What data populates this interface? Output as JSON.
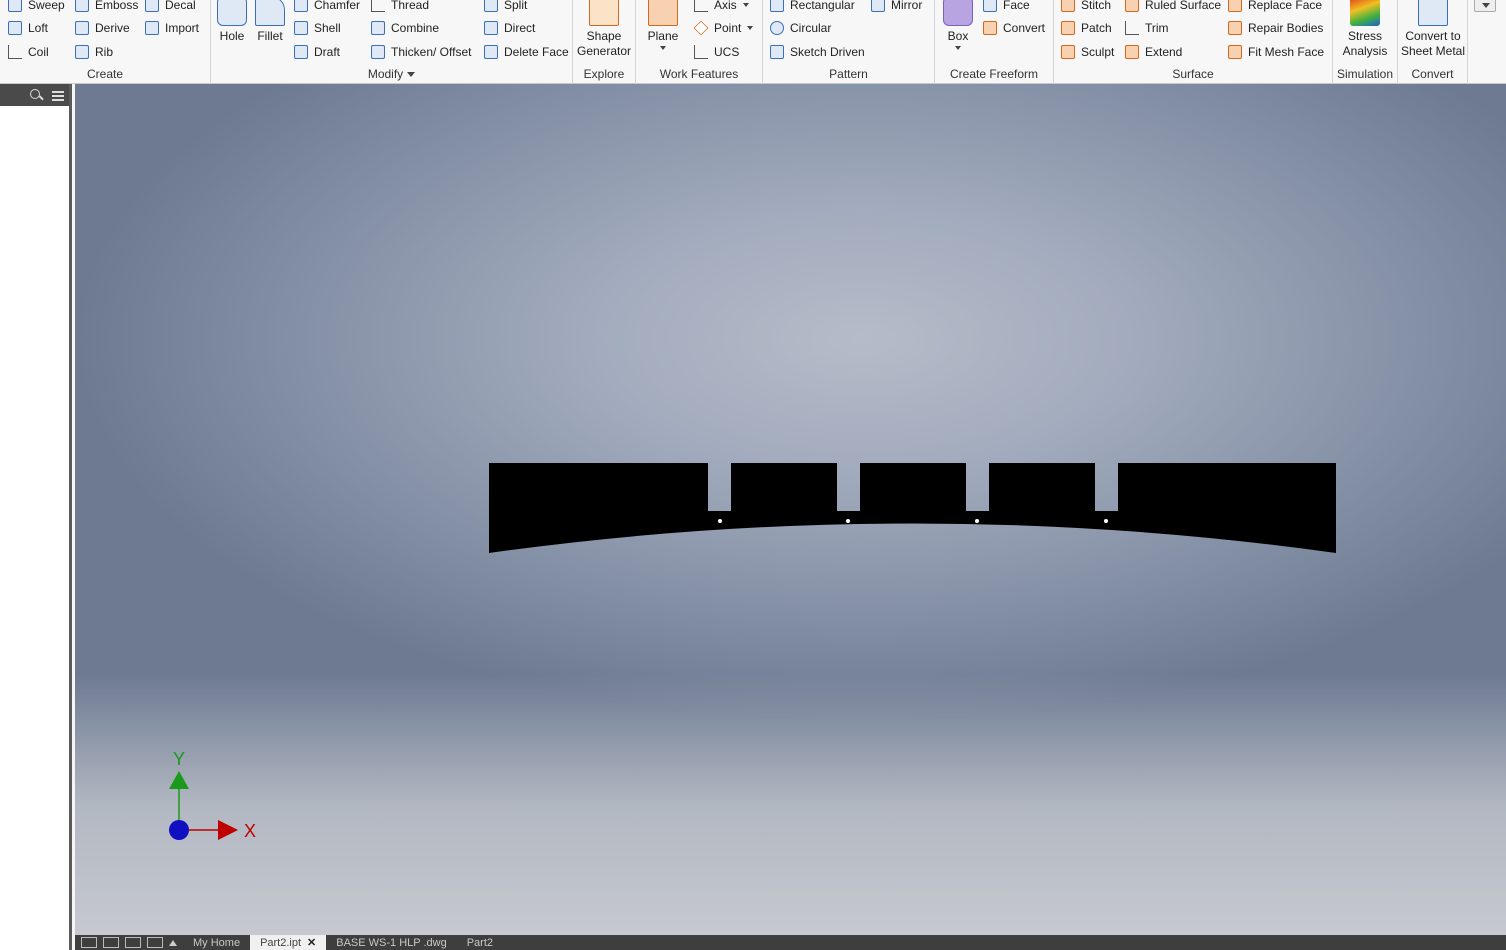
{
  "ribbon": {
    "create": {
      "title": "Create",
      "items": [
        "Sweep",
        "Emboss",
        "Decal",
        "Loft",
        "Derive",
        "Import",
        "Coil",
        "Rib"
      ]
    },
    "modify": {
      "title": "Modify",
      "large": [
        "Hole",
        "Fillet"
      ],
      "items": [
        "Chamfer",
        "Thread",
        "Split",
        "Shell",
        "Combine",
        "Direct",
        "Draft",
        "Thicken/ Offset",
        "Delete Face"
      ]
    },
    "explore": {
      "title": "Explore",
      "large_line1": "Shape",
      "large_line2": "Generator"
    },
    "work_features": {
      "title": "Work Features",
      "large": "Plane",
      "items": [
        "Axis",
        "Point",
        "UCS"
      ]
    },
    "pattern": {
      "title": "Pattern",
      "items": [
        "Rectangular",
        "Mirror",
        "Circular",
        "Sketch Driven"
      ]
    },
    "create_freeform": {
      "title": "Create Freeform",
      "large": "Box",
      "items": [
        "Face",
        "Convert"
      ]
    },
    "surface": {
      "title": "Surface",
      "items": [
        "Stitch",
        "Ruled Surface",
        "Replace Face",
        "Patch",
        "Trim",
        "Repair Bodies",
        "Sculpt",
        "Extend",
        "Fit Mesh Face"
      ]
    },
    "simulation": {
      "title": "Simulation",
      "large_line1": "Stress",
      "large_line2": "Analysis"
    },
    "convert": {
      "title": "Convert",
      "large_line1": "Convert to",
      "large_line2": "Sheet Metal"
    }
  },
  "viewport": {
    "triad": {
      "x_label": "X",
      "y_label": "Y"
    },
    "colors": {
      "part": "#000000",
      "x_axis": "#c00000",
      "y_axis": "#1a9a1a",
      "origin": "#1010c0"
    }
  },
  "tabs": {
    "items": [
      "My Home",
      "Part2.ipt",
      "BASE WS-1 HLP .dwg",
      "Part2"
    ],
    "active_index": 1
  },
  "icons": {
    "browser_search": "search-icon",
    "browser_menu": "hamburger-menu-icon",
    "tab_close": "close-icon"
  }
}
